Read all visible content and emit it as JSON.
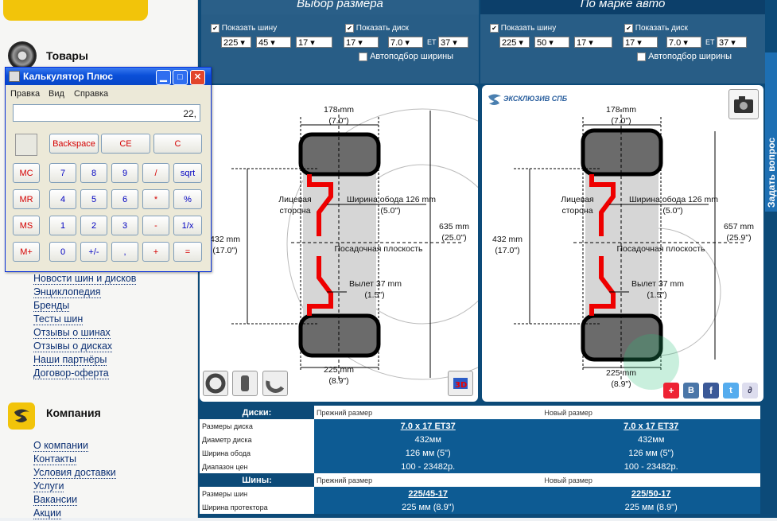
{
  "sidebar": {
    "products_title": "Товары",
    "links": [
      "Новости шин и дисков",
      "Энциклопедия",
      "Бренды",
      "Тесты шин",
      "Отзывы о шинах",
      "Отзывы о дисках",
      "Наши партнёры",
      "Договор-оферта"
    ],
    "company_title": "Компания",
    "company_links": [
      "О компании",
      "Контакты",
      "Условия доставки",
      "Услуги",
      "Вакансии",
      "Акции"
    ]
  },
  "tabs": {
    "size": "Выбор размера",
    "brand": "По марке авто"
  },
  "left_panel": {
    "tire_cb": "Показать шину",
    "disk_cb": "Показать диск",
    "width": "225",
    "profile": "45",
    "diameter": "17",
    "disk_d": "17",
    "disk_w": "7.0",
    "et_label": "ET",
    "et": "37",
    "auto": "Автоподбор ширины"
  },
  "right_panel": {
    "tire_cb": "Показать шину",
    "disk_cb": "Показать диск",
    "width": "225",
    "profile": "50",
    "diameter": "17",
    "disk_d": "17",
    "disk_w": "7.0",
    "et_label": "ET",
    "et": "37",
    "auto": "Автоподбор ширины"
  },
  "diagram_left": {
    "width_mm": "178 mm",
    "width_in": "(7.0\")",
    "face": "Лицевая",
    "face2": "сторона",
    "rim": "Ширина обода 126 mm",
    "rim_in": "(5.0\")",
    "diam_mm": "432 mm",
    "diam_in": "(17.0\")",
    "outer_mm": "635 mm",
    "outer_in": "(25.0\")",
    "seat": "Посадочная плоскость",
    "offset": "Вылет 37 mm",
    "offset_in": "(1.5\")",
    "tire_mm": "225 mm",
    "tire_in": "(8.9\")"
  },
  "diagram_right": {
    "logo": "ЭКСКЛЮЗИВ СПБ",
    "width_mm": "178 mm",
    "width_in": "(7.0\")",
    "face": "Лицевая",
    "face2": "сторона",
    "rim": "Ширина обода 126 mm",
    "rim_in": "(5.0\")",
    "diam_mm": "432 mm",
    "diam_in": "(17.0\")",
    "outer_mm": "657 mm",
    "outer_in": "(25.9\")",
    "seat": "Посадочная плоскость",
    "offset": "Вылет 37 mm",
    "offset_in": "(1.5\")",
    "tire_mm": "225 mm",
    "tire_in": "(8.9\")"
  },
  "side_tab": "Задать вопрос",
  "disks": {
    "header": "Диски:",
    "prev": "Прежний размер",
    "new": "Новый размер",
    "rows": [
      {
        "label": "Размеры диска",
        "prev": "7.0 x 17 ET37",
        "new": "7.0 x 17 ET37"
      },
      {
        "label": "Диаметр диска",
        "prev": "432мм",
        "new": "432мм"
      },
      {
        "label": "Ширина обода",
        "prev": "126 мм (5\")",
        "new": "126 мм (5\")"
      },
      {
        "label": "Диапазон цен",
        "prev": "100 - 23482р.",
        "new": "100 - 23482р."
      }
    ]
  },
  "tires": {
    "header": "Шины:",
    "prev": "Прежний размер",
    "new": "Новый размер",
    "rows": [
      {
        "label": "Размеры шин",
        "prev": "225/45-17",
        "new": "225/50-17"
      },
      {
        "label": "Ширина протектора",
        "prev": "225 мм (8.9\")",
        "new": "225 мм (8.9\")"
      }
    ]
  },
  "calculator": {
    "title": "Калькулятор Плюс",
    "menu": [
      "Правка",
      "Вид",
      "Справка"
    ],
    "display": "22,",
    "top_buttons": [
      "Backspace",
      "CE",
      "C"
    ],
    "rows": [
      [
        "MC",
        "7",
        "8",
        "9",
        "/",
        "sqrt"
      ],
      [
        "MR",
        "4",
        "5",
        "6",
        "*",
        "%"
      ],
      [
        "MS",
        "1",
        "2",
        "3",
        "-",
        "1/x"
      ],
      [
        "M+",
        "0",
        "+/-",
        ",",
        "+",
        "="
      ]
    ]
  }
}
